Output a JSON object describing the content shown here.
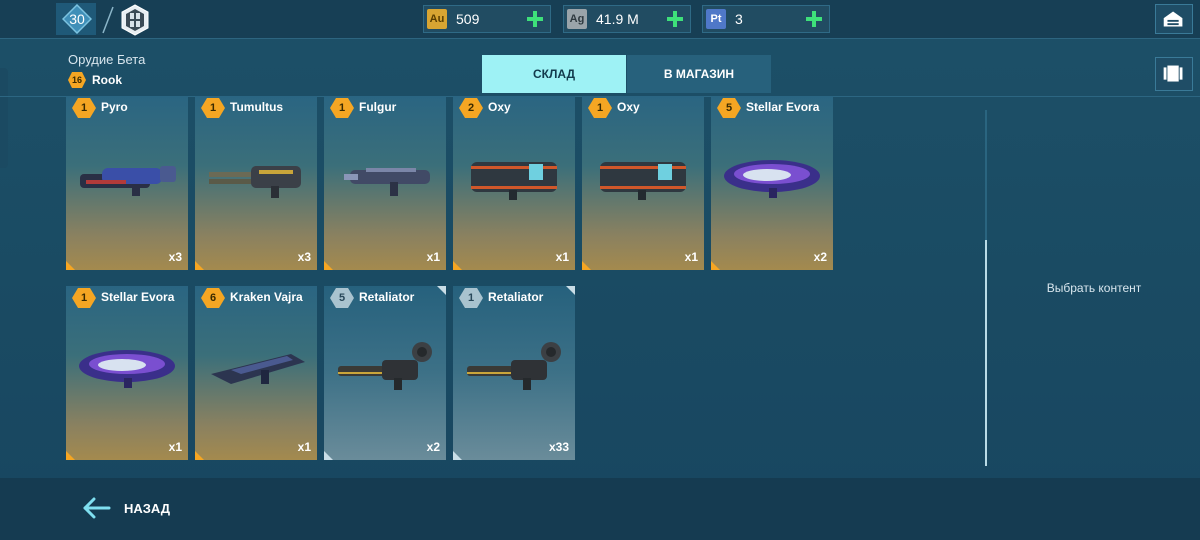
{
  "topbar": {
    "player_level": "30",
    "resources": [
      {
        "badge": "Au",
        "value": "509",
        "badge_color": "#d8a532"
      },
      {
        "badge": "Ag",
        "value": "41.9 M",
        "badge_color": "#9aa4aa"
      },
      {
        "badge": "Pt",
        "value": "3",
        "badge_color": "#4f78c8"
      }
    ]
  },
  "header": {
    "weapon_slot_title": "Орудие Бета",
    "robot_level": "16",
    "robot_name": "Rook"
  },
  "tabs": {
    "storage": "СКЛАД",
    "to_shop": "В МАГАЗИН"
  },
  "items": [
    {
      "level": "1",
      "name": "Pyro",
      "qty": "x3",
      "rarity": "gold"
    },
    {
      "level": "1",
      "name": "Tumultus",
      "qty": "x3",
      "rarity": "gold"
    },
    {
      "level": "1",
      "name": "Fulgur",
      "qty": "x1",
      "rarity": "gold"
    },
    {
      "level": "2",
      "name": "Oxy",
      "qty": "x1",
      "rarity": "gold"
    },
    {
      "level": "1",
      "name": "Oxy",
      "qty": "x1",
      "rarity": "gold"
    },
    {
      "level": "5",
      "name": "Stellar Evora",
      "qty": "x2",
      "rarity": "gold"
    },
    {
      "level": "1",
      "name": "Stellar Evora",
      "qty": "x1",
      "rarity": "gold"
    },
    {
      "level": "6",
      "name": "Kraken Vajra",
      "qty": "x1",
      "rarity": "gold"
    },
    {
      "level": "5",
      "name": "Retaliator",
      "qty": "x2",
      "rarity": "grey"
    },
    {
      "level": "1",
      "name": "Retaliator",
      "qty": "x33",
      "rarity": "grey"
    }
  ],
  "side_panel": {
    "select_content": "Выбрать контент"
  },
  "footer": {
    "back_label": "НАЗАД"
  }
}
